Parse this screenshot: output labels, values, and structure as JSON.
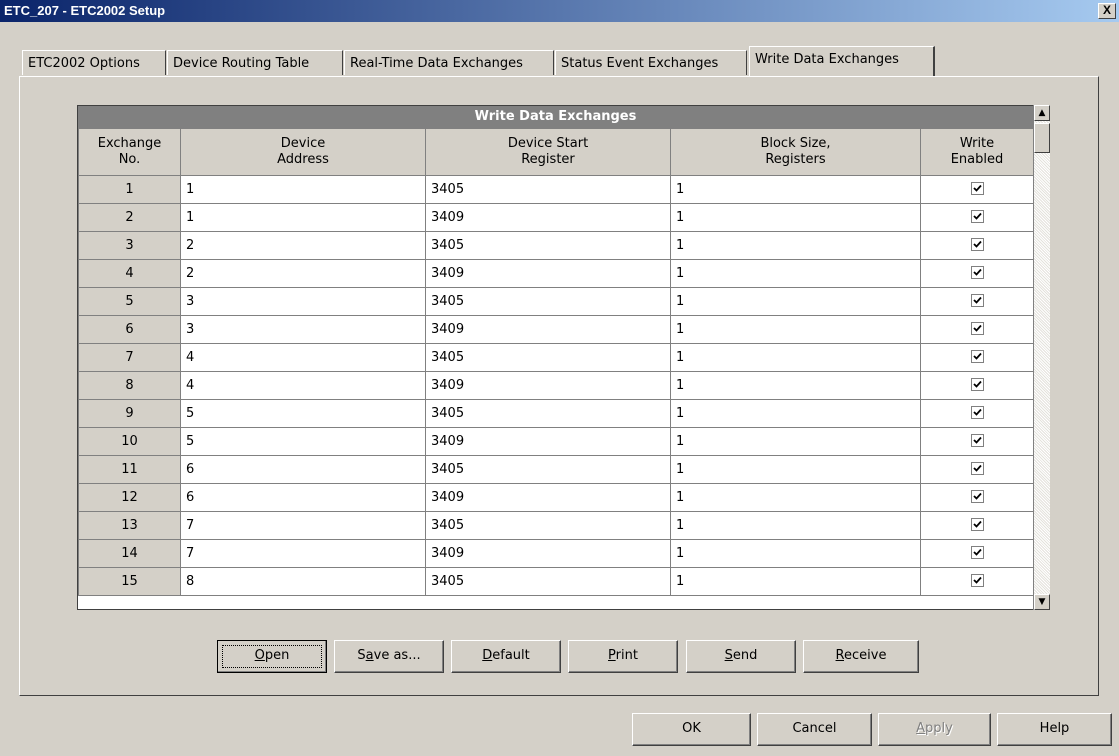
{
  "window": {
    "title": "ETC_207 - ETC2002 Setup",
    "close_label": "X"
  },
  "tabs": [
    {
      "label": "ETC2002 Options"
    },
    {
      "label": "Device Routing Table"
    },
    {
      "label": "Real-Time Data Exchanges"
    },
    {
      "label": "Status Event Exchanges"
    },
    {
      "label": "Write Data Exchanges"
    }
  ],
  "grid": {
    "title": "Write Data Exchanges",
    "headers": {
      "exchange": [
        "Exchange",
        "No."
      ],
      "address": [
        "Device",
        "Address"
      ],
      "start": [
        "Device Start",
        "Register"
      ],
      "block": [
        "Block Size,",
        "Registers"
      ],
      "enabled": [
        "Write",
        "Enabled"
      ]
    },
    "rows": [
      {
        "no": "1",
        "address": "1",
        "start": "3405",
        "block": "1",
        "enabled": true
      },
      {
        "no": "2",
        "address": "1",
        "start": "3409",
        "block": "1",
        "enabled": true
      },
      {
        "no": "3",
        "address": "2",
        "start": "3405",
        "block": "1",
        "enabled": true
      },
      {
        "no": "4",
        "address": "2",
        "start": "3409",
        "block": "1",
        "enabled": true
      },
      {
        "no": "5",
        "address": "3",
        "start": "3405",
        "block": "1",
        "enabled": true
      },
      {
        "no": "6",
        "address": "3",
        "start": "3409",
        "block": "1",
        "enabled": true
      },
      {
        "no": "7",
        "address": "4",
        "start": "3405",
        "block": "1",
        "enabled": true
      },
      {
        "no": "8",
        "address": "4",
        "start": "3409",
        "block": "1",
        "enabled": true
      },
      {
        "no": "9",
        "address": "5",
        "start": "3405",
        "block": "1",
        "enabled": true
      },
      {
        "no": "10",
        "address": "5",
        "start": "3409",
        "block": "1",
        "enabled": true
      },
      {
        "no": "11",
        "address": "6",
        "start": "3405",
        "block": "1",
        "enabled": true
      },
      {
        "no": "12",
        "address": "6",
        "start": "3409",
        "block": "1",
        "enabled": true
      },
      {
        "no": "13",
        "address": "7",
        "start": "3405",
        "block": "1",
        "enabled": true
      },
      {
        "no": "14",
        "address": "7",
        "start": "3409",
        "block": "1",
        "enabled": true
      },
      {
        "no": "15",
        "address": "8",
        "start": "3405",
        "block": "1",
        "enabled": true
      }
    ]
  },
  "actions": {
    "open": {
      "u": "O",
      "rest": "pen"
    },
    "save": {
      "pre": "S",
      "u": "a",
      "rest": "ve as..."
    },
    "default": {
      "u": "D",
      "rest": "efault"
    },
    "print": {
      "u": "P",
      "rest": "rint"
    },
    "send": {
      "u": "S",
      "rest": "end"
    },
    "receive": {
      "u": "R",
      "rest": "eceive"
    }
  },
  "dialog": {
    "ok": "OK",
    "cancel": "Cancel",
    "apply": {
      "u": "A",
      "rest": "pply"
    },
    "help": "Help"
  }
}
